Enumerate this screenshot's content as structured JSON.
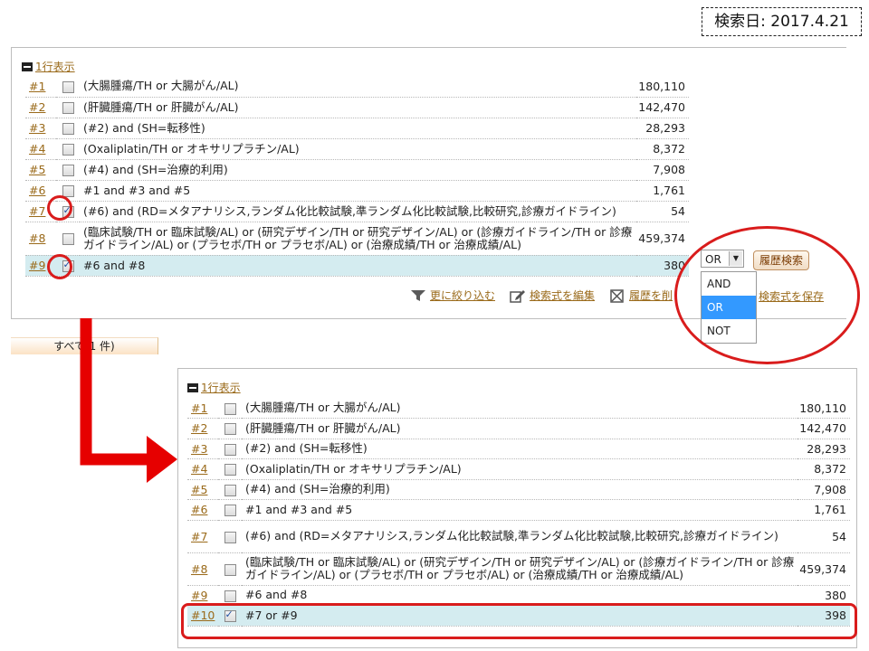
{
  "search_date": "検索日: 2017.4.21",
  "one_line_label": "1行表示",
  "panel1": {
    "rows": [
      {
        "id": "#1",
        "checked": false,
        "query": "(大腸腫瘍/TH or 大腸がん/AL)",
        "count": "180,110"
      },
      {
        "id": "#2",
        "checked": false,
        "query": "(肝臓腫瘍/TH or 肝臓がん/AL)",
        "count": "142,470"
      },
      {
        "id": "#3",
        "checked": false,
        "query": "(#2) and (SH=転移性)",
        "count": "28,293"
      },
      {
        "id": "#4",
        "checked": false,
        "query": "(Oxaliplatin/TH or オキサリプラチン/AL)",
        "count": "8,372"
      },
      {
        "id": "#5",
        "checked": false,
        "query": "(#4) and (SH=治療的利用)",
        "count": "7,908"
      },
      {
        "id": "#6",
        "checked": false,
        "query": "#1 and #3 and #5",
        "count": "1,761"
      },
      {
        "id": "#7",
        "checked": true,
        "query": "(#6) and (RD=メタアナリシス,ランダム化比較試験,準ランダム化比較試験,比較研究,診療ガイドライン)",
        "count": "54"
      },
      {
        "id": "#8",
        "checked": false,
        "query": "(臨床試験/TH or 臨床試験/AL) or (研究デザイン/TH or 研究デザイン/AL) or (診療ガイドライン/TH or 診療ガイドライン/AL) or (プラセボ/TH or プラセボ/AL) or (治療成績/TH or 治療成績/AL)",
        "count": "459,374"
      },
      {
        "id": "#9",
        "checked": true,
        "query": "#6 and #8",
        "count": "380"
      }
    ],
    "actions": {
      "refine": "更に絞り込む",
      "edit": "検索式を編集",
      "delete": "履歴を削",
      "save": "検索式を保存"
    },
    "operator": {
      "selected": "OR",
      "options": [
        "AND",
        "OR",
        "NOT"
      ],
      "history_search_button": "履歴検索"
    },
    "tab_all": "すべて(1 件)"
  },
  "panel2": {
    "rows": [
      {
        "id": "#1",
        "checked": false,
        "query": "(大腸腫瘍/TH or 大腸がん/AL)",
        "count": "180,110"
      },
      {
        "id": "#2",
        "checked": false,
        "query": "(肝臓腫瘍/TH or 肝臓がん/AL)",
        "count": "142,470"
      },
      {
        "id": "#3",
        "checked": false,
        "query": "(#2) and (SH=転移性)",
        "count": "28,293"
      },
      {
        "id": "#4",
        "checked": false,
        "query": "(Oxaliplatin/TH or オキサリプラチン/AL)",
        "count": "8,372"
      },
      {
        "id": "#5",
        "checked": false,
        "query": "(#4) and (SH=治療的利用)",
        "count": "7,908"
      },
      {
        "id": "#6",
        "checked": false,
        "query": "#1 and #3 and #5",
        "count": "1,761"
      },
      {
        "id": "#7",
        "checked": false,
        "query": "(#6) and (RD=メタアナリシス,ランダム化比較試験,準ランダム化比較試験,比較研究,診療ガイドライン)",
        "count": "54"
      },
      {
        "id": "#8",
        "checked": false,
        "query": "(臨床試験/TH or 臨床試験/AL) or (研究デザイン/TH or 研究デザイン/AL) or (診療ガイドライン/TH or 診療ガイドライン/AL) or (プラセボ/TH or プラセボ/AL) or (治療成績/TH or 治療成績/AL)",
        "count": "459,374"
      },
      {
        "id": "#9",
        "checked": false,
        "query": "#6 and #8",
        "count": "380"
      },
      {
        "id": "#10",
        "checked": true,
        "query": "#7 or #9",
        "count": "398"
      }
    ]
  },
  "colors": {
    "annotation": "#d91c1c",
    "highlight_row": "#d4ecf0",
    "link": "#9a6a1a",
    "select_highlight": "#3399ff"
  }
}
